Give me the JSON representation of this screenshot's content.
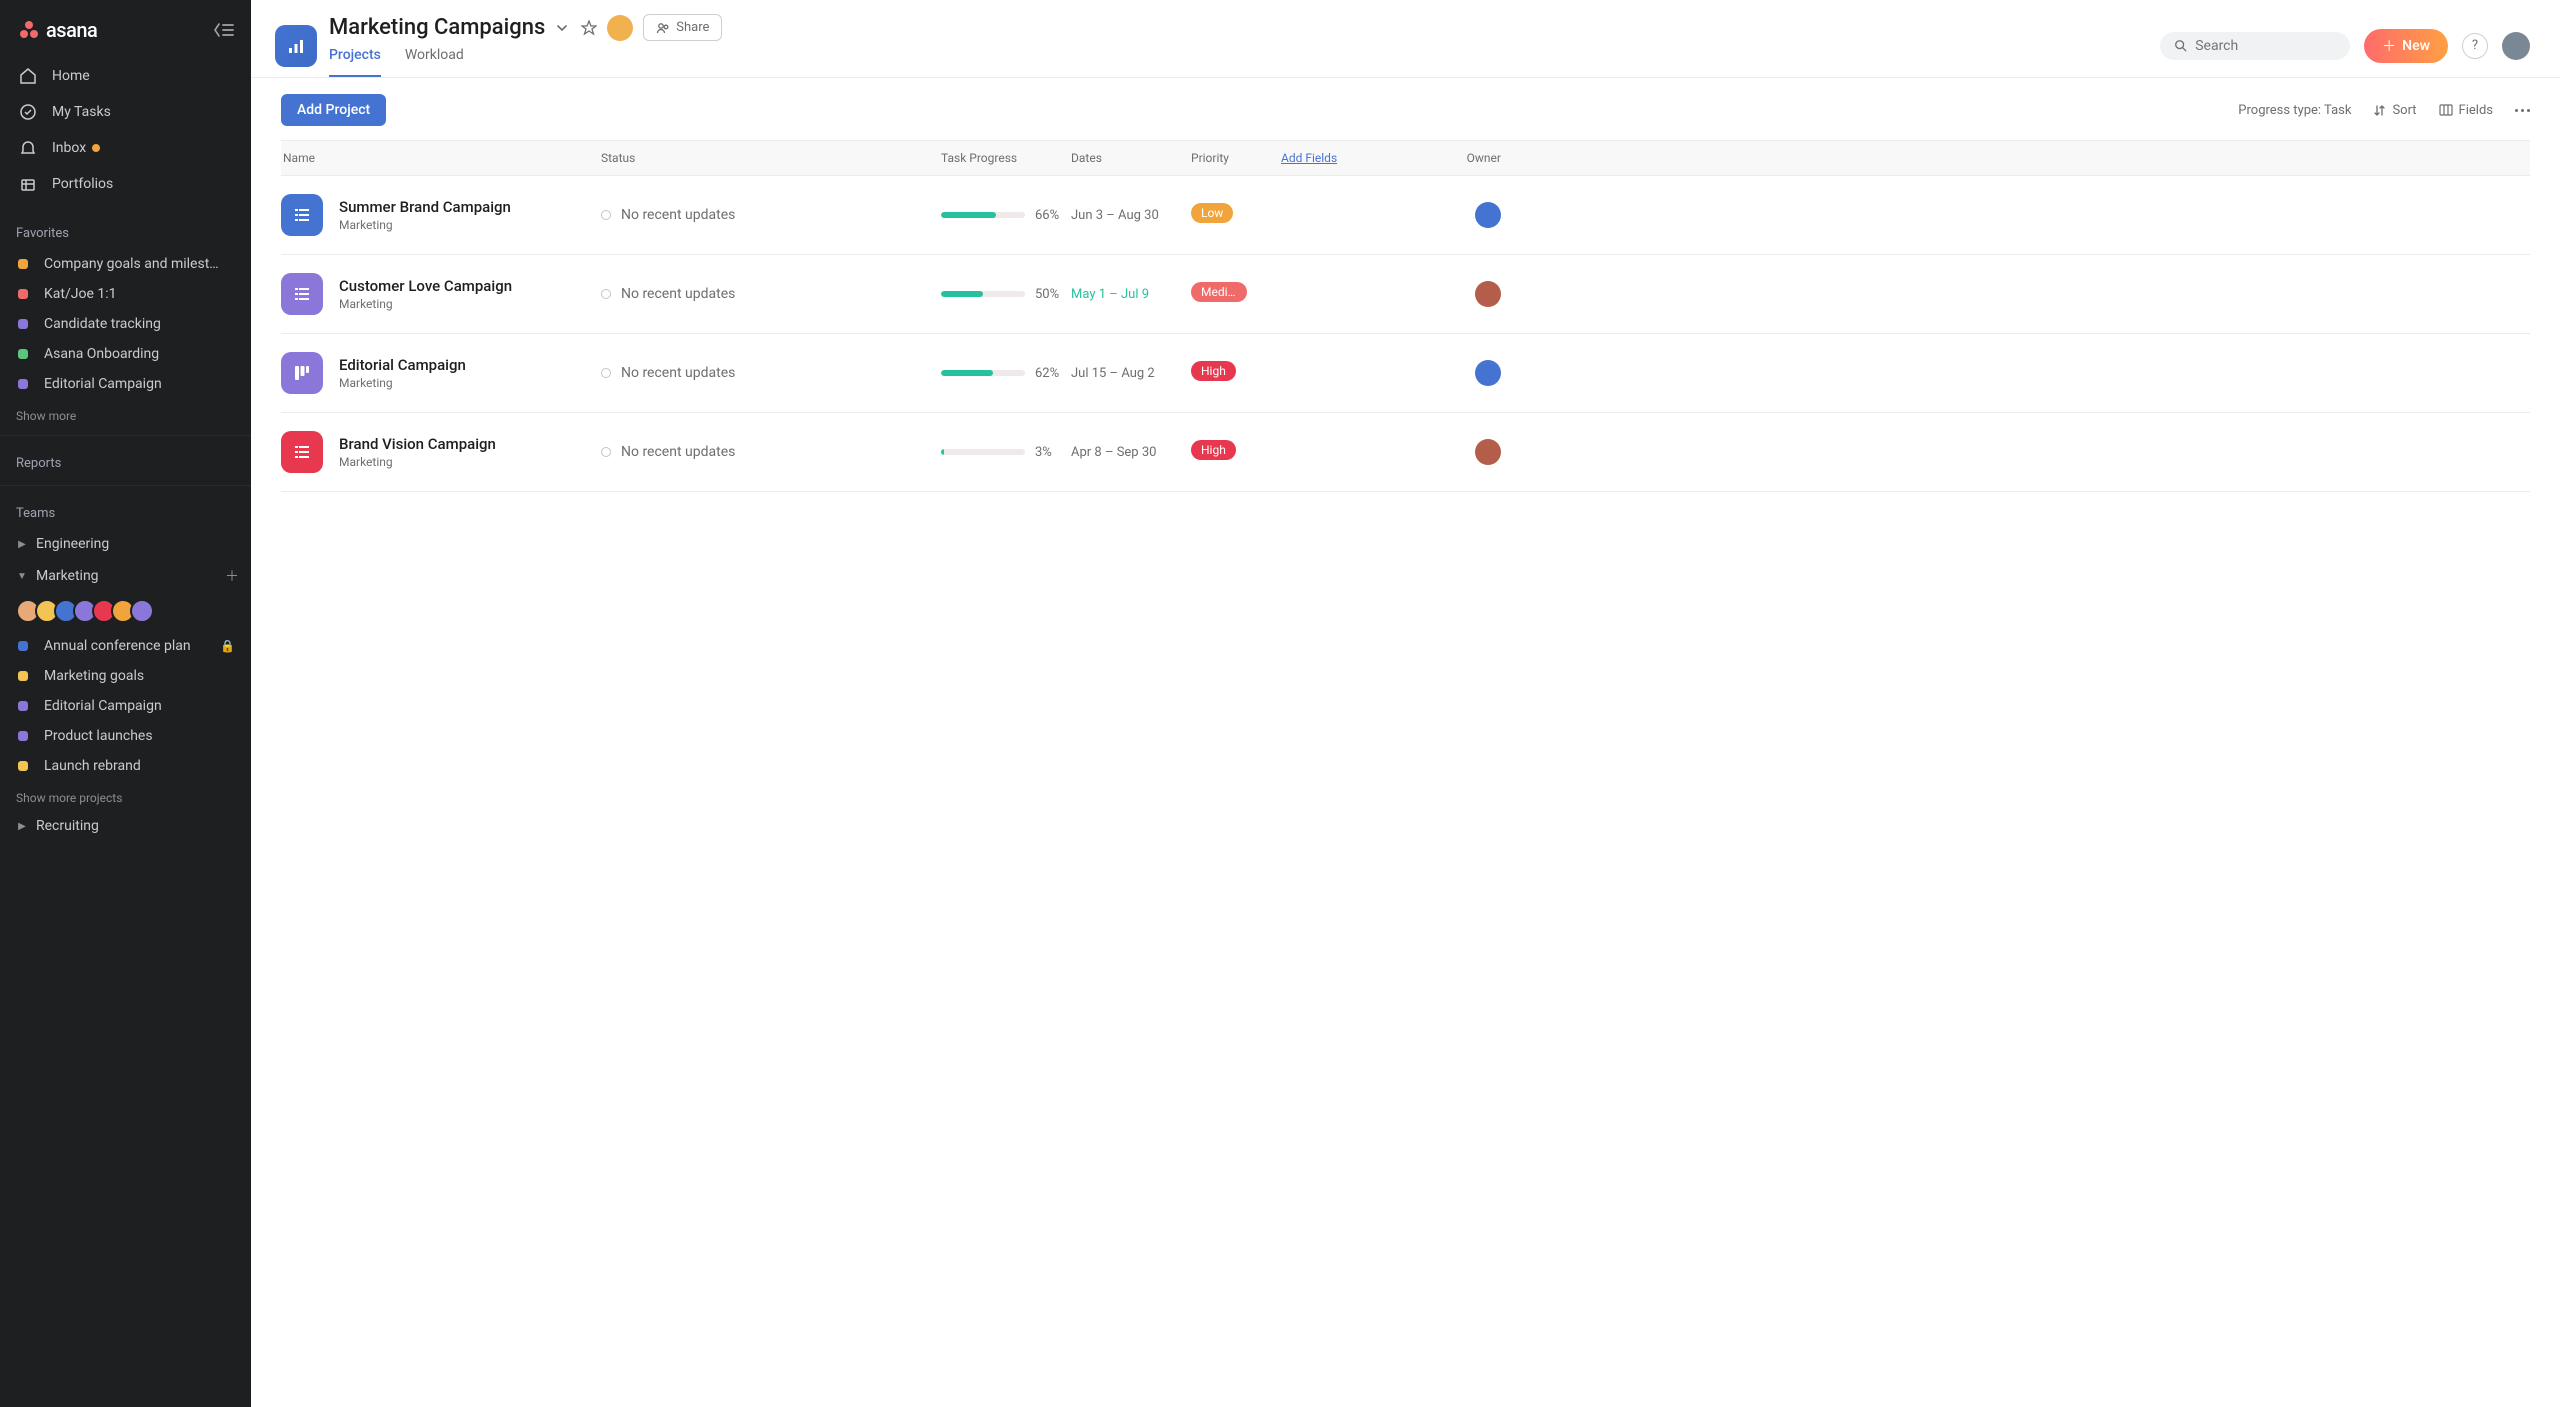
{
  "brand": "asana",
  "sidebar": {
    "nav": [
      {
        "label": "Home"
      },
      {
        "label": "My Tasks"
      },
      {
        "label": "Inbox",
        "has_dot": true
      },
      {
        "label": "Portfolios"
      }
    ],
    "favorites_label": "Favorites",
    "favorites": [
      {
        "label": "Company goals and milest…",
        "color": "#f1a43c"
      },
      {
        "label": "Kat/Joe 1:1",
        "color": "#f06a6a"
      },
      {
        "label": "Candidate tracking",
        "color": "#8a77d9"
      },
      {
        "label": "Asana Onboarding",
        "color": "#5bc57a"
      },
      {
        "label": "Editorial Campaign",
        "color": "#8a77d9"
      }
    ],
    "show_more": "Show more",
    "reports_label": "Reports",
    "teams_label": "Teams",
    "teams": {
      "engineering": "Engineering",
      "marketing": "Marketing",
      "recruiting": "Recruiting"
    },
    "team_avatar_colors": [
      "#e7a977",
      "#f1c453",
      "#4573d2",
      "#8a77d9",
      "#e8384f",
      "#f1a43c",
      "#8a77d9"
    ],
    "marketing_projects": [
      {
        "label": "Annual conference plan",
        "color": "#4573d2",
        "locked": true
      },
      {
        "label": "Marketing goals",
        "color": "#f1c453"
      },
      {
        "label": "Editorial Campaign",
        "color": "#8a77d9"
      },
      {
        "label": "Product launches",
        "color": "#8a77d9"
      },
      {
        "label": "Launch rebrand",
        "color": "#f1c453"
      }
    ],
    "show_more_projects": "Show more projects"
  },
  "header": {
    "title": "Marketing Campaigns",
    "tabs": [
      "Projects",
      "Workload"
    ],
    "active_tab": 0,
    "share_label": "Share",
    "search_placeholder": "Search",
    "new_label": "New"
  },
  "toolbar": {
    "add_project": "Add Project",
    "progress_type": "Progress type: Task",
    "sort": "Sort",
    "fields": "Fields"
  },
  "columns": {
    "name": "Name",
    "status": "Status",
    "task_progress": "Task Progress",
    "dates": "Dates",
    "priority": "Priority",
    "add_fields": "Add Fields",
    "owner": "Owner"
  },
  "status_text": "No recent updates",
  "projects": [
    {
      "name": "Summer Brand Campaign",
      "sub": "Marketing",
      "icon_bg": "#4573d2",
      "percent": "66%",
      "bar": 66,
      "dates": "Jun 3 – Aug 30",
      "dates_accent": false,
      "priority": "Low",
      "badge_bg": "#f1a43c",
      "owner_bg": "#4573d2"
    },
    {
      "name": "Customer Love Campaign",
      "sub": "Marketing",
      "icon_bg": "#8a77d9",
      "percent": "50%",
      "bar": 50,
      "dates": "May 1 – Jul 9",
      "dates_accent": true,
      "priority": "Medium",
      "badge_bg": "#f06a6a",
      "owner_bg": "#b35d4a"
    },
    {
      "name": "Editorial Campaign",
      "sub": "Marketing",
      "icon_bg": "#8a77d9",
      "percent": "62%",
      "bar": 62,
      "dates": "Jul 15 – Aug 2",
      "dates_accent": false,
      "priority": "High",
      "badge_bg": "#e8384f",
      "owner_bg": "#4573d2",
      "board_icon": true
    },
    {
      "name": "Brand Vision Campaign",
      "sub": "Marketing",
      "icon_bg": "#e8384f",
      "percent": "3%",
      "bar": 3,
      "dates": "Apr 8 – Sep 30",
      "dates_accent": false,
      "priority": "High",
      "badge_bg": "#e8384f",
      "owner_bg": "#b35d4a"
    }
  ]
}
